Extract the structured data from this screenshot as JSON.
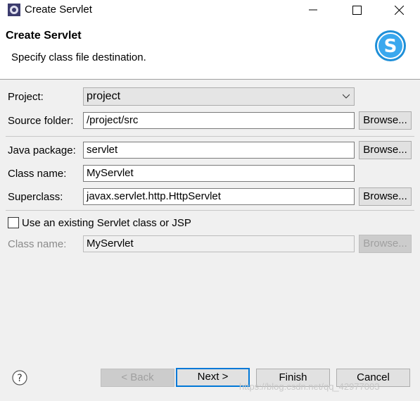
{
  "window": {
    "title": "Create Servlet",
    "controls": [
      "minimize",
      "maximize",
      "close"
    ]
  },
  "banner": {
    "title": "Create Servlet",
    "description": "Specify class file destination.",
    "logo_letter": "S"
  },
  "form": {
    "project": {
      "label": "Project:",
      "value": "project"
    },
    "source_folder": {
      "label": "Source folder:",
      "value": "/project/src",
      "browse": "Browse..."
    },
    "java_package": {
      "label": "Java package:",
      "value": "servlet",
      "browse": "Browse..."
    },
    "class_name": {
      "label": "Class name:",
      "value": "MyServlet"
    },
    "superclass": {
      "label": "Superclass:",
      "value": "javax.servlet.http.HttpServlet",
      "browse": "Browse..."
    },
    "existing": {
      "checkbox_label": "Use an existing Servlet class or JSP",
      "checked": false,
      "class_label": "Class name:",
      "class_value": "MyServlet",
      "browse": "Browse..."
    }
  },
  "footer": {
    "help_glyph": "?",
    "back": "< Back",
    "next": "Next >",
    "finish": "Finish",
    "cancel": "Cancel"
  },
  "watermark": "https://blog.csdn.net/qq_42977003",
  "colors": {
    "default_button_border": "#0078d7",
    "logo_blue": "#1e8fd8"
  }
}
